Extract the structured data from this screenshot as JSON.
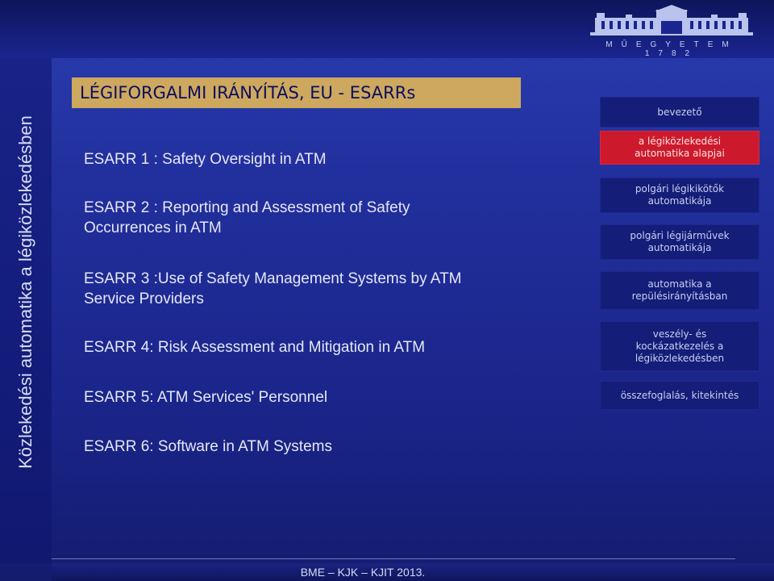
{
  "sidebar": {
    "vertical_title": "Közlekedési automatika a légiközlekedésben"
  },
  "logo": {
    "icon": "university-building-icon",
    "text": "MŰEGYETEM 1782"
  },
  "header": {
    "title": "LÉGIFORGALMI IRÁNYÍTÁS, EU - ESARRs"
  },
  "esarr_items": [
    {
      "line1": "ESARR 1 : Safety Oversight in ATM",
      "line2": ""
    },
    {
      "line1": "ESARR 2 : Reporting and Assessment of Safety",
      "line2": "Occurrences in ATM"
    },
    {
      "line1": "ESARR 3 :Use of Safety Management Systems by ATM",
      "line2": "Service Providers"
    },
    {
      "line1": "ESARR 4: Risk Assessment and Mitigation in ATM",
      "line2": ""
    },
    {
      "line1": "ESARR 5: ATM Services' Personnel",
      "line2": ""
    },
    {
      "line1": "ESARR 6: Software in ATM Systems",
      "line2": ""
    }
  ],
  "nav": {
    "items": [
      {
        "line1": "bevezető",
        "line2": "",
        "line3": ""
      },
      {
        "line1": "a légiközlekedési",
        "line2": "automatika alapjai",
        "line3": ""
      },
      {
        "line1": "polgári légikikötők",
        "line2": "automatikája",
        "line3": ""
      },
      {
        "line1": "polgári légijárművek",
        "line2": "automatikája",
        "line3": ""
      },
      {
        "line1": "automatika a",
        "line2": "repülésirányításban",
        "line3": ""
      },
      {
        "line1": "veszély- és",
        "line2": "kockázatkezelés a",
        "line3": "légiközlekedésben"
      },
      {
        "line1": "összefoglalás, kitekintés",
        "line2": "",
        "line3": ""
      }
    ],
    "active_index": 1,
    "colors": {
      "active": "#cc1a2c",
      "inactive": "#141d78"
    }
  },
  "footer": {
    "text": "BME – KJK – KJIT 2013."
  },
  "colors": {
    "background": "#22309e",
    "header_bar": "#cda85e",
    "header_text": "#0b0f5e"
  }
}
